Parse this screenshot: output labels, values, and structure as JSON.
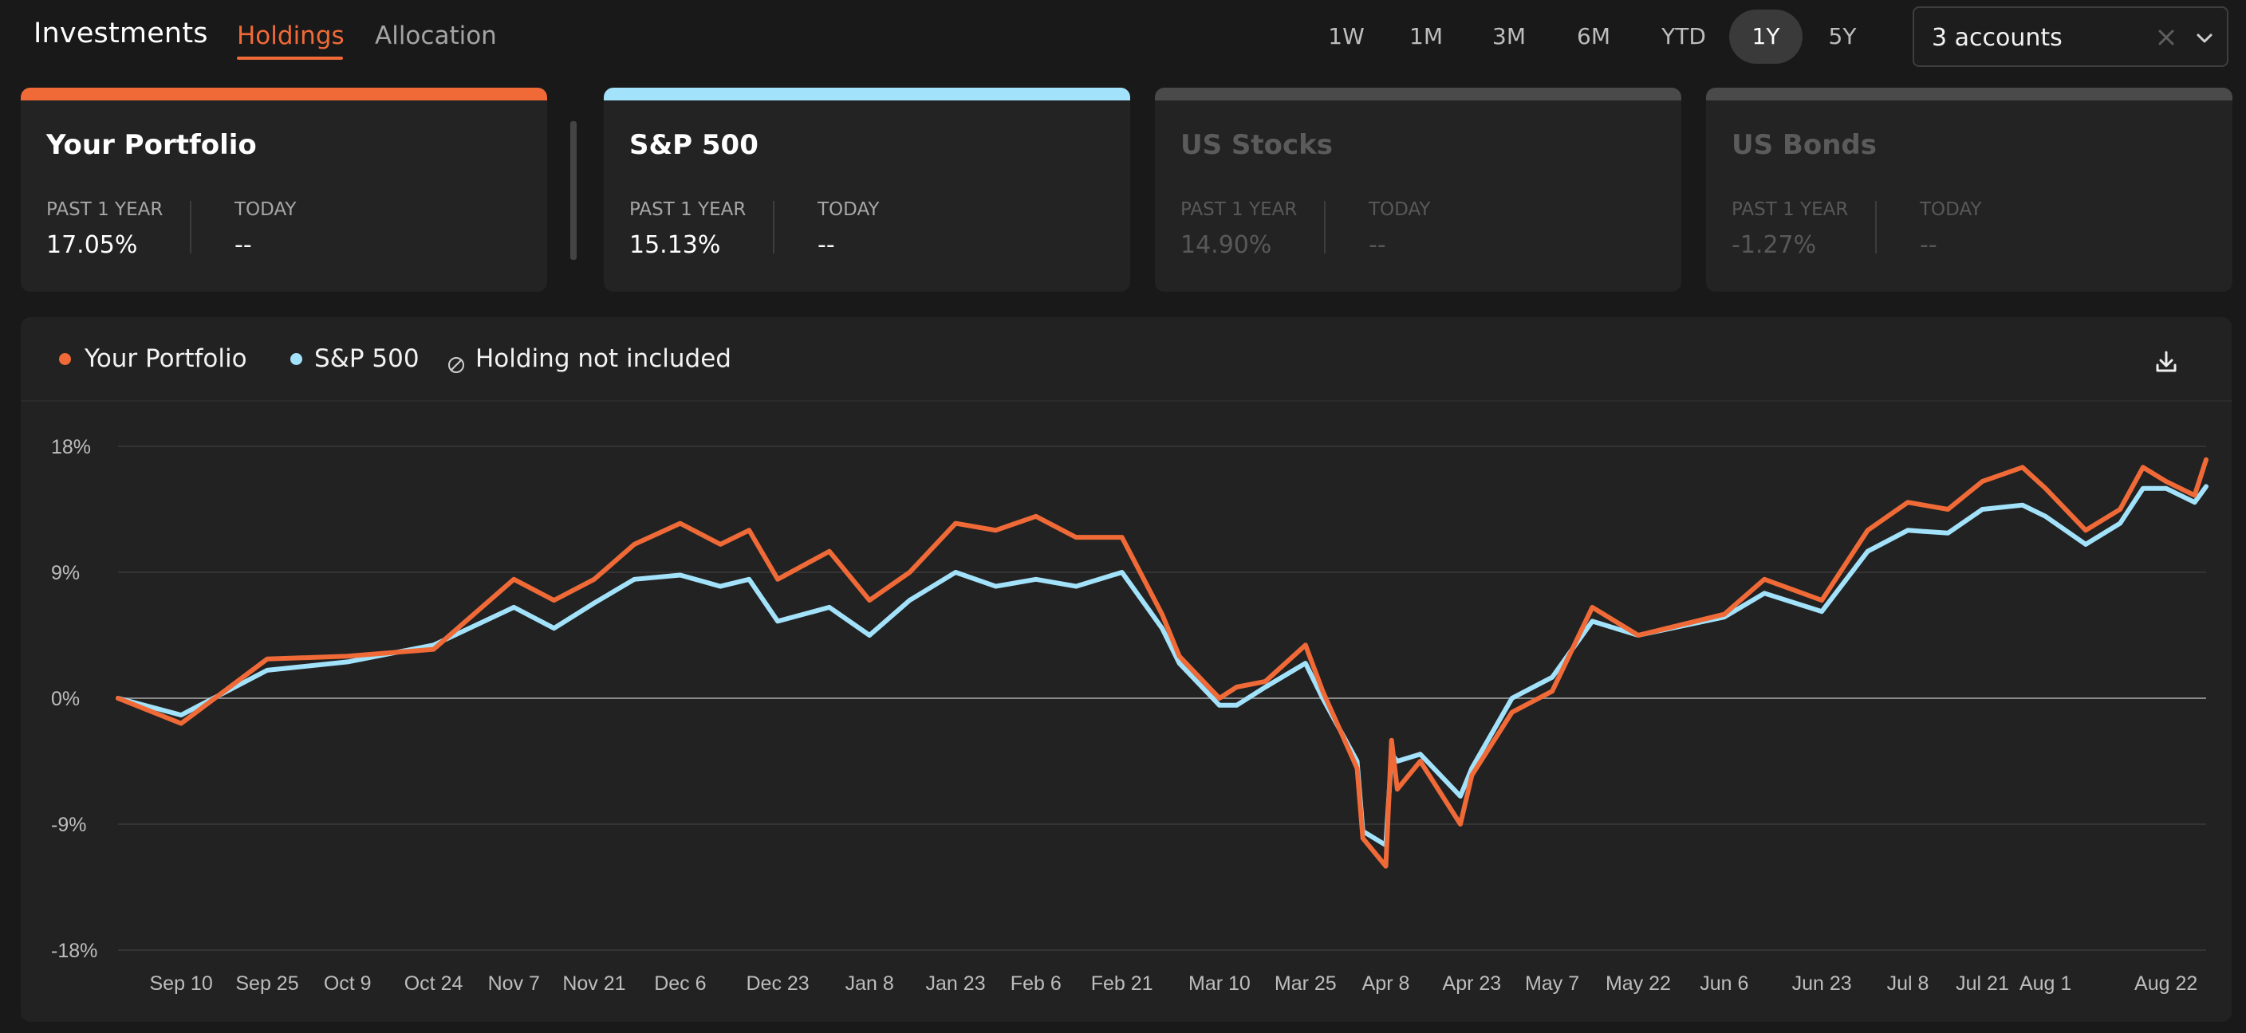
{
  "header": {
    "title": "Investments",
    "tabs": [
      {
        "label": "Holdings",
        "active": true
      },
      {
        "label": "Allocation",
        "active": false
      }
    ],
    "ranges": [
      "1W",
      "1M",
      "3M",
      "6M",
      "YTD",
      "1Y",
      "5Y"
    ],
    "active_range": "1Y",
    "account_select": {
      "value": "3 accounts",
      "clear_icon": "close-icon",
      "toggle_icon": "chevron-down-icon"
    }
  },
  "cards": [
    {
      "title": "Your Portfolio",
      "color": "#f06a37",
      "past_label": "PAST 1 YEAR",
      "past_value": "17.05%",
      "today_label": "TODAY",
      "today_value": "--",
      "active": true
    },
    {
      "title": "S&P 500",
      "color": "#a3e2fb",
      "past_label": "PAST 1 YEAR",
      "past_value": "15.13%",
      "today_label": "TODAY",
      "today_value": "--",
      "active": true
    },
    {
      "title": "US Stocks",
      "color": "#4a4a4a",
      "past_label": "PAST 1 YEAR",
      "past_value": "14.90%",
      "today_label": "TODAY",
      "today_value": "--",
      "active": false
    },
    {
      "title": "US Bonds",
      "color": "#4a4a4a",
      "past_label": "PAST 1 YEAR",
      "past_value": "-1.27%",
      "today_label": "TODAY",
      "today_value": "--",
      "active": false
    }
  ],
  "legend": {
    "portfolio": "Your Portfolio",
    "sp500": "S&P 500",
    "excluded": "Holding not included",
    "excluded_icon": "empty-set-icon"
  },
  "download_icon": "download-icon",
  "colors": {
    "portfolio": "#f06a37",
    "sp500": "#a3e2fb",
    "grid": "#3a3a3a",
    "zero_line": "#8a8a8a"
  },
  "chart_data": {
    "type": "line",
    "ylim": [
      -18,
      18
    ],
    "yticks": [
      "18%",
      "9%",
      "0%",
      "-9%",
      "-18%"
    ],
    "ytick_values": [
      18,
      9,
      0,
      -9,
      -18
    ],
    "xticks": [
      "Sep 10",
      "Sep 25",
      "Oct 9",
      "Oct 24",
      "Nov 7",
      "Nov 21",
      "Dec 6",
      "Dec 23",
      "Jan 8",
      "Jan 23",
      "Feb 6",
      "Feb 21",
      "Mar 10",
      "Mar 25",
      "Apr 8",
      "Apr 23",
      "May 7",
      "May 22",
      "Jun 6",
      "Jun 23",
      "Jul 8",
      "Jul 21",
      "Aug 1",
      "Aug 22"
    ],
    "x": [
      "Aug 30",
      "Sep 10",
      "Sep 25",
      "Oct 9",
      "Oct 24",
      "Nov 7",
      "Nov 14",
      "Nov 21",
      "Nov 28",
      "Dec 6",
      "Dec 13",
      "Dec 18",
      "Dec 23",
      "Jan 1",
      "Jan 8",
      "Jan 15",
      "Jan 23",
      "Jan 30",
      "Feb 6",
      "Feb 13",
      "Feb 21",
      "Feb 28",
      "Mar 3",
      "Mar 10",
      "Mar 13",
      "Mar 18",
      "Mar 25",
      "Mar 28",
      "Apr 3",
      "Apr 4",
      "Apr 8",
      "Apr 9",
      "Apr 10",
      "Apr 14",
      "Apr 21",
      "Apr 23",
      "Apr 30",
      "May 7",
      "May 14",
      "May 22",
      "Jun 6",
      "Jun 13",
      "Jun 23",
      "Jul 1",
      "Jul 8",
      "Jul 15",
      "Jul 21",
      "Jul 28",
      "Aug 1",
      "Aug 8",
      "Aug 14",
      "Aug 18",
      "Aug 22",
      "Aug 27",
      "Aug 29"
    ],
    "series": [
      {
        "name": "Your Portfolio",
        "values": [
          0,
          -1.8,
          2.8,
          3.0,
          3.5,
          8.5,
          7.0,
          8.5,
          11.0,
          12.5,
          11.0,
          12.0,
          8.5,
          10.5,
          7.0,
          9.0,
          12.5,
          12.0,
          13.0,
          11.5,
          11.5,
          6.0,
          3.0,
          0.0,
          0.8,
          1.2,
          3.8,
          0.5,
          -5.0,
          -10.0,
          -12.0,
          -3.0,
          -6.5,
          -4.5,
          -9.0,
          -5.5,
          -1.0,
          0.5,
          6.5,
          4.5,
          6.0,
          8.5,
          7.0,
          12.0,
          14.0,
          13.5,
          15.5,
          16.5,
          15.0,
          12.0,
          13.5,
          16.5,
          15.5,
          14.5,
          17.05
        ]
      },
      {
        "name": "S&P 500",
        "values": [
          0,
          -1.2,
          2.0,
          2.6,
          3.8,
          6.5,
          5.0,
          6.8,
          8.5,
          8.8,
          8.0,
          8.5,
          5.5,
          6.5,
          4.5,
          7.0,
          9.0,
          8.0,
          8.5,
          8.0,
          9.0,
          5.0,
          2.5,
          -0.5,
          -0.5,
          0.8,
          2.5,
          0.0,
          -4.5,
          -9.5,
          -10.5,
          -4.0,
          -4.5,
          -4.0,
          -7.0,
          -5.0,
          0.0,
          1.5,
          5.5,
          4.5,
          5.8,
          7.5,
          6.2,
          10.5,
          12.0,
          11.8,
          13.5,
          13.8,
          13.0,
          11.0,
          12.5,
          15.0,
          15.0,
          14.0,
          15.13
        ]
      }
    ]
  }
}
